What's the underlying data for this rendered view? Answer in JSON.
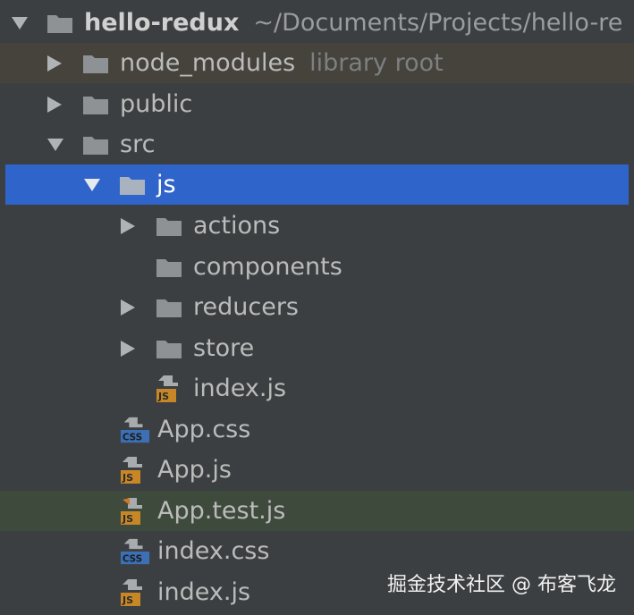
{
  "tree": {
    "root": {
      "label": "hello-redux",
      "path": "~/Documents/Projects/hello-re"
    },
    "node_modules": {
      "label": "node_modules",
      "hint": "library root"
    },
    "public": {
      "label": "public"
    },
    "src": {
      "label": "src"
    },
    "js": {
      "label": "js"
    },
    "actions": {
      "label": "actions"
    },
    "components": {
      "label": "components"
    },
    "reducers": {
      "label": "reducers"
    },
    "store": {
      "label": "store"
    },
    "index_js_inner": {
      "label": "index.js"
    },
    "app_css": {
      "label": "App.css"
    },
    "app_js": {
      "label": "App.js"
    },
    "app_test_js": {
      "label": "App.test.js"
    },
    "index_css": {
      "label": "index.css"
    },
    "index_js": {
      "label": "index.js"
    }
  },
  "icons": {
    "folder": "folder-icon",
    "js_file": "js-file-icon",
    "css_file": "css-file-icon",
    "test_file": "test-file-icon",
    "expanded": "chevron-down-icon",
    "collapsed": "chevron-right-icon"
  },
  "colors": {
    "background": "#3c3f41",
    "selection": "#2f65ca",
    "library_row": "#45433c",
    "test_row": "#3e4a3b",
    "folder": "#8e9295",
    "js_badge": "#c78727",
    "css_badge": "#3c6fb4"
  },
  "watermark": "掘金技术社区 @ 布客飞龙"
}
